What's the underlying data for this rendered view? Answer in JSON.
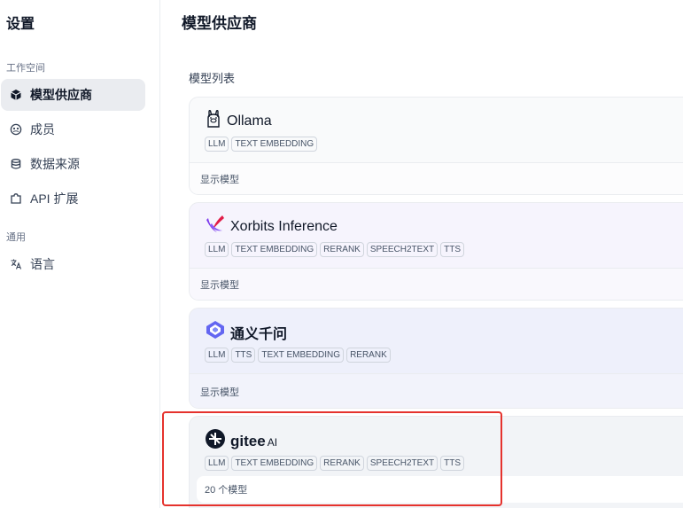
{
  "sidebar": {
    "title": "设置",
    "workspace_label": "工作空间",
    "general_label": "通用",
    "items": [
      {
        "label": "模型供应商",
        "icon": "cube-icon",
        "active": true
      },
      {
        "label": "成员",
        "icon": "members-icon",
        "active": false
      },
      {
        "label": "数据来源",
        "icon": "database-icon",
        "active": false
      },
      {
        "label": "API 扩展",
        "icon": "puzzle-icon",
        "active": false
      },
      {
        "label": "语言",
        "icon": "translate-icon",
        "active": false
      }
    ]
  },
  "main": {
    "title": "模型供应商",
    "list_label": "模型列表",
    "providers": [
      {
        "name": "Ollama",
        "icon": "llama-icon",
        "tags": [
          "LLM",
          "TEXT EMBEDDING"
        ],
        "footer": "显示模型"
      },
      {
        "name": "Xorbits Inference",
        "icon": "xorbits-icon",
        "tags": [
          "LLM",
          "TEXT EMBEDDING",
          "RERANK",
          "SPEECH2TEXT",
          "TTS"
        ],
        "footer": "显示模型"
      },
      {
        "name": "通义千问",
        "icon": "tongyi-icon",
        "tags": [
          "LLM",
          "TTS",
          "TEXT EMBEDDING",
          "RERANK"
        ],
        "footer": "显示模型"
      },
      {
        "name": "gitee",
        "name_suffix": "AI",
        "icon": "gitee-icon",
        "tags": [
          "LLM",
          "TEXT EMBEDDING",
          "RERANK",
          "SPEECH2TEXT",
          "TTS"
        ],
        "footer": "20 个模型"
      }
    ]
  },
  "colors": {
    "highlight": "#e5322d",
    "active_nav_bg": "#eaecf0",
    "xorbits_purple": "#7c3aed"
  }
}
